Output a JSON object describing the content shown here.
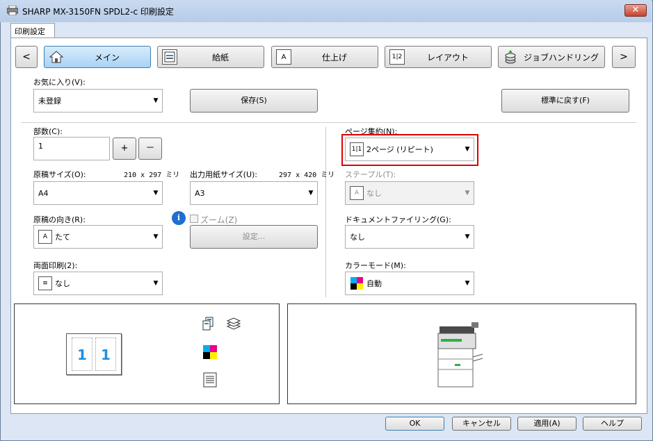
{
  "window": {
    "title": "SHARP MX-3150FN SPDL2-c 印刷設定",
    "close_label": "✕"
  },
  "tabs": {
    "active": "印刷設定"
  },
  "nav": {
    "prev": "<",
    "next": ">",
    "items": [
      {
        "label": "メイン",
        "icon": "home-icon"
      },
      {
        "label": "給紙",
        "icon": "paper-tray-icon"
      },
      {
        "label": "仕上げ",
        "icon": "finish-icon"
      },
      {
        "label": "レイアウト",
        "icon": "layout-icon"
      },
      {
        "label": "ジョブハンドリング",
        "icon": "job-handling-icon"
      }
    ]
  },
  "favorites": {
    "label": "お気に入り(V):",
    "value": "未登録",
    "save": "保存(S)",
    "reset": "標準に戻す(F)"
  },
  "copies": {
    "label": "部数(C):",
    "value": "1",
    "plus": "+",
    "minus": "－"
  },
  "original_size": {
    "label": "原稿サイズ(O):",
    "dims": "210 x 297 ミリ",
    "value": "A4"
  },
  "output_size": {
    "label": "出力用紙サイズ(U):",
    "dims": "297 x 420 ミリ",
    "value": "A3"
  },
  "orientation": {
    "label": "原稿の向き(R):",
    "value": "たて"
  },
  "zoom": {
    "label": "ズーム(Z)",
    "settings": "設定..."
  },
  "duplex": {
    "label": "両面印刷(2):",
    "value": "なし"
  },
  "nup": {
    "label": "ページ集約(N):",
    "value": "2ページ (リピート)",
    "icon_text": "1|1",
    "highlight_color": "#e00000"
  },
  "staple": {
    "label": "ステープル(T):",
    "value": "なし"
  },
  "filing": {
    "label": "ドキュメントファイリング(G):",
    "value": "なし"
  },
  "color_mode": {
    "label": "カラーモード(M):",
    "value": "自動"
  },
  "preview": {
    "page_left": "1",
    "page_right": "1"
  },
  "footer": {
    "ok": "OK",
    "cancel": "キャンセル",
    "apply": "適用(A)",
    "help": "ヘルプ"
  },
  "colors": {
    "accent_blue": "#1e90e0",
    "info_blue": "#1f6fd0"
  }
}
